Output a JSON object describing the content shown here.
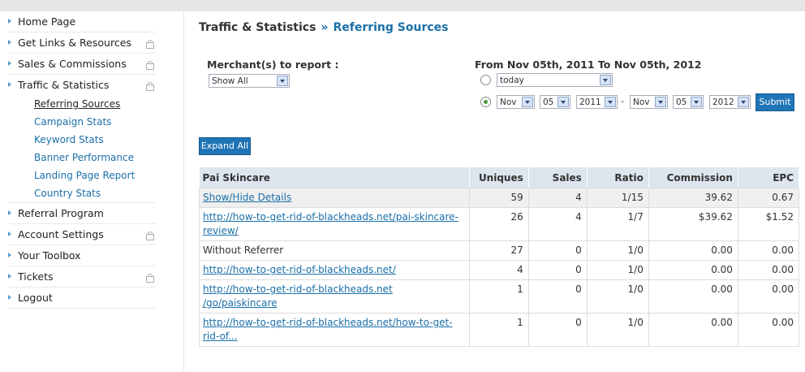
{
  "sidebar": {
    "items": [
      {
        "label": "Home Page",
        "locked": false
      },
      {
        "label": "Get Links & Resources",
        "locked": true
      },
      {
        "label": "Sales & Commissions",
        "locked": true
      },
      {
        "label": "Traffic & Statistics",
        "locked": true
      },
      {
        "label": "Referral Program",
        "locked": false
      },
      {
        "label": "Account Settings",
        "locked": true
      },
      {
        "label": "Your Toolbox",
        "locked": false
      },
      {
        "label": "Tickets",
        "locked": true
      },
      {
        "label": "Logout",
        "locked": false
      }
    ],
    "subitems": [
      {
        "label": "Referring Sources",
        "active": true
      },
      {
        "label": "Campaign Stats",
        "active": false
      },
      {
        "label": "Keyword Stats",
        "active": false
      },
      {
        "label": "Banner Performance",
        "active": false
      },
      {
        "label": "Landing Page Report",
        "active": false
      },
      {
        "label": "Country Stats",
        "active": false
      }
    ]
  },
  "header": {
    "section": "Traffic & Statistics",
    "separator": "»",
    "current": "Referring Sources"
  },
  "filters": {
    "merchant_label": "Merchant(s) to report :",
    "merchant_value": "Show All",
    "date_range_label": "From Nov 05th, 2011 To Nov 05th, 2012",
    "preset_value": "today",
    "preset_selected": false,
    "custom_selected": true,
    "from_month": "Nov",
    "from_day": "05",
    "from_year": "2011",
    "dash": "-",
    "to_month": "Nov",
    "to_day": "05",
    "to_year": "2012",
    "submit_label": "Submit"
  },
  "expand_all_label": "Expand All",
  "table": {
    "columns": [
      "Pai Skincare",
      "Uniques",
      "Sales",
      "Ratio",
      "Commission",
      "EPC"
    ],
    "summary": {
      "label": "Show/Hide Details",
      "uniques": "59",
      "sales": "4",
      "ratio": "1/15",
      "commission": "39.62",
      "epc": "0.67"
    },
    "rows": [
      {
        "source": "http://how-to-get-rid-of-blackheads.net/pai-skincare-review/",
        "link": true,
        "uniques": "26",
        "sales": "4",
        "ratio": "1/7",
        "commission": "$39.62",
        "epc": "$1.52"
      },
      {
        "source": "Without Referrer",
        "link": false,
        "uniques": "27",
        "sales": "0",
        "ratio": "1/0",
        "commission": "0.00",
        "epc": "0.00"
      },
      {
        "source": "http://how-to-get-rid-of-blackheads.net/",
        "link": true,
        "uniques": "4",
        "sales": "0",
        "ratio": "1/0",
        "commission": "0.00",
        "epc": "0.00"
      },
      {
        "source": "http://how-to-get-rid-of-blackheads.net /go/paiskincare",
        "link": true,
        "uniques": "1",
        "sales": "0",
        "ratio": "1/0",
        "commission": "0.00",
        "epc": "0.00"
      },
      {
        "source": "http://how-to-get-rid-of-blackheads.net/how-to-get-rid-of...",
        "link": true,
        "uniques": "1",
        "sales": "0",
        "ratio": "1/0",
        "commission": "0.00",
        "epc": "0.00"
      }
    ]
  }
}
